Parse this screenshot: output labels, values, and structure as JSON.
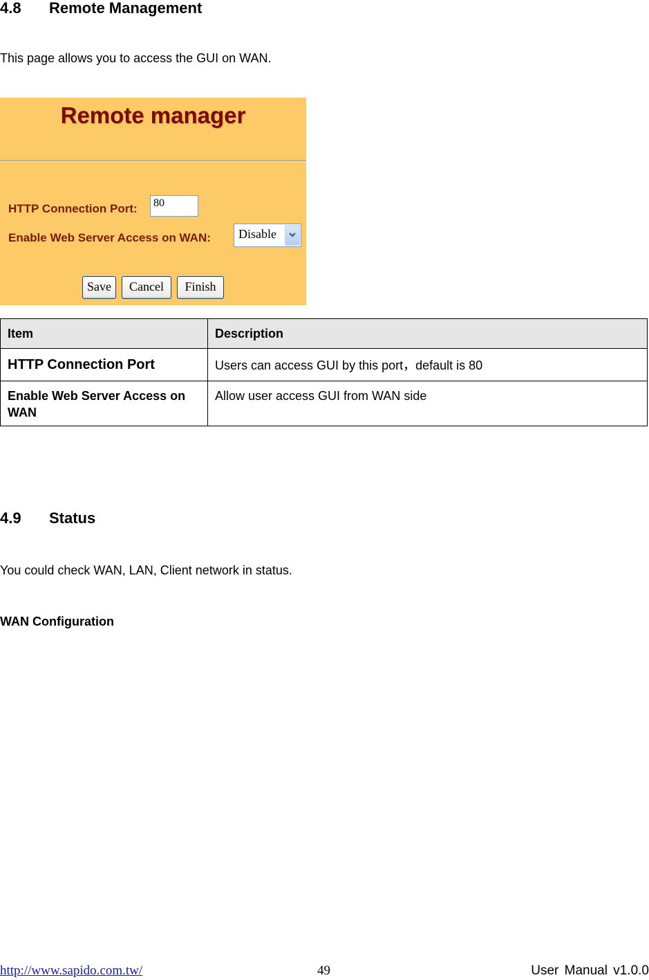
{
  "section_48": {
    "number": "4.8",
    "title": "Remote Management",
    "intro": "This page allows you to access the GUI on WAN."
  },
  "router_ui": {
    "title": "Remote manager",
    "http_port_label": "HTTP Connection Port:",
    "http_port_value": "80",
    "wan_access_label": "Enable Web Server Access on WAN:",
    "wan_access_selected": "Disable",
    "dropdown_icon": "chevron-down-icon",
    "buttons": {
      "save": "Save",
      "cancel": "Cancel",
      "finish": "Finish"
    },
    "colors": {
      "background": "#fdca68",
      "title": "#7a0c05",
      "label": "#7a1a0a"
    }
  },
  "table": {
    "headers": [
      "Item",
      "Description"
    ],
    "rows": [
      {
        "item": "HTTP Connection Port",
        "description": "Users can access GUI by this port，default is 80"
      },
      {
        "item": "Enable Web Server Access on WAN",
        "description": "Allow user access GUI from WAN side"
      }
    ]
  },
  "section_49": {
    "number": "4.9",
    "title": "Status",
    "intro": "You could check WAN, LAN, Client network in status.",
    "subheading": "WAN Configuration"
  },
  "footer": {
    "url": "http://www.sapido.com.tw/",
    "page_number": "49",
    "version": "User  Manual  v1.0.0"
  }
}
